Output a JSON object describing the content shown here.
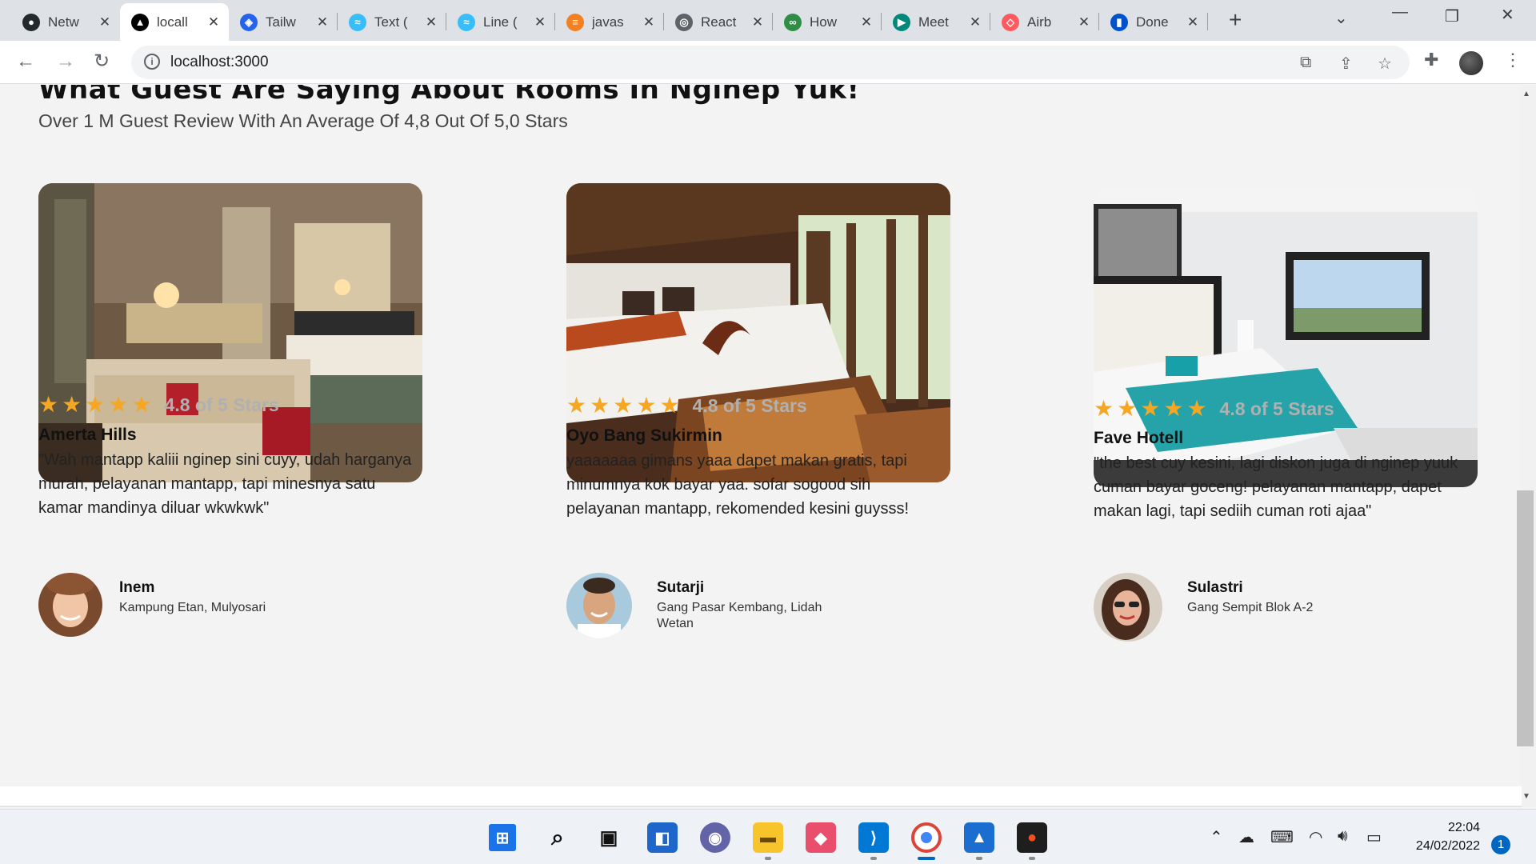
{
  "browser": {
    "tabs": [
      {
        "label": "Netw",
        "icon": "github-icon",
        "color": "#24292e",
        "glyph": "●"
      },
      {
        "label": "locall",
        "icon": "vercel-icon",
        "color": "#000000",
        "glyph": "▲",
        "active": true
      },
      {
        "label": "Tailw",
        "icon": "tailwind-ui-icon",
        "color": "#2563eb",
        "glyph": "◈"
      },
      {
        "label": "Text (",
        "icon": "tailwind-icon",
        "color": "#38bdf8",
        "glyph": "≈"
      },
      {
        "label": "Line (",
        "icon": "tailwind-icon",
        "color": "#38bdf8",
        "glyph": "≈"
      },
      {
        "label": "javas",
        "icon": "stackoverflow-icon",
        "color": "#f48024",
        "glyph": "≡"
      },
      {
        "label": "React",
        "icon": "globe-icon",
        "color": "#5f6368",
        "glyph": "◎"
      },
      {
        "label": "How",
        "icon": "geeksforgeeks-icon",
        "color": "#2f8d46",
        "glyph": "∞"
      },
      {
        "label": "Meet",
        "icon": "google-meet-icon",
        "color": "#00897b",
        "glyph": "▶"
      },
      {
        "label": "Airb",
        "icon": "airbnb-icon",
        "color": "#ff5a5f",
        "glyph": "◇"
      },
      {
        "label": "Done",
        "icon": "trello-icon",
        "color": "#0052cc",
        "glyph": "▮"
      }
    ],
    "url": "localhost:3000"
  },
  "section": {
    "title": "What Guest Are Saying About Rooms In Nginep Yuk!",
    "subtitle": "Over 1 M Guest Review With An Average Of 4,8 Out Of 5,0 Stars"
  },
  "reviews": [
    {
      "rating_text": "4.8 of 5 Stars",
      "stars": 5,
      "hotel": "Amerta Hills",
      "review": "\"Wah mantapp kaliii nginep sini cuyy, udah harganya murah, pelayanan mantapp, tapi minesnya satu kamar mandinya diluar wkwkwk\"",
      "guest_name": "Inem",
      "guest_address": "Kampung Etan, Mulyosari"
    },
    {
      "rating_text": "4.8 of 5 Stars",
      "stars": 5,
      "hotel": "Oyo Bang Sukirmin",
      "review": "yaaaaaaa gimans yaaa dapet makan gratis, tapi minumnya kok bayar yaa. sofar sogood sih pelayanan mantapp, rekomended kesini guysss!",
      "guest_name": "Sutarji",
      "guest_address": "Gang Pasar Kembang, Lidah Wetan"
    },
    {
      "rating_text": "4.8 of 5 Stars",
      "stars": 5,
      "hotel": "Fave Hotell",
      "review": "\"the best cuy kesini, lagi diskon juga di nginep yuuk cuman bayar goceng! pelayanan mantapp, dapet makan lagi, tapi sediih cuman roti ajaa\"",
      "guest_name": "Sulastri",
      "guest_address": "Gang Sempit Blok A-2"
    }
  ],
  "star_color": "#f5a623",
  "taskbar": {
    "time": "22:04",
    "date": "24/02/2022",
    "notifications": "1"
  }
}
